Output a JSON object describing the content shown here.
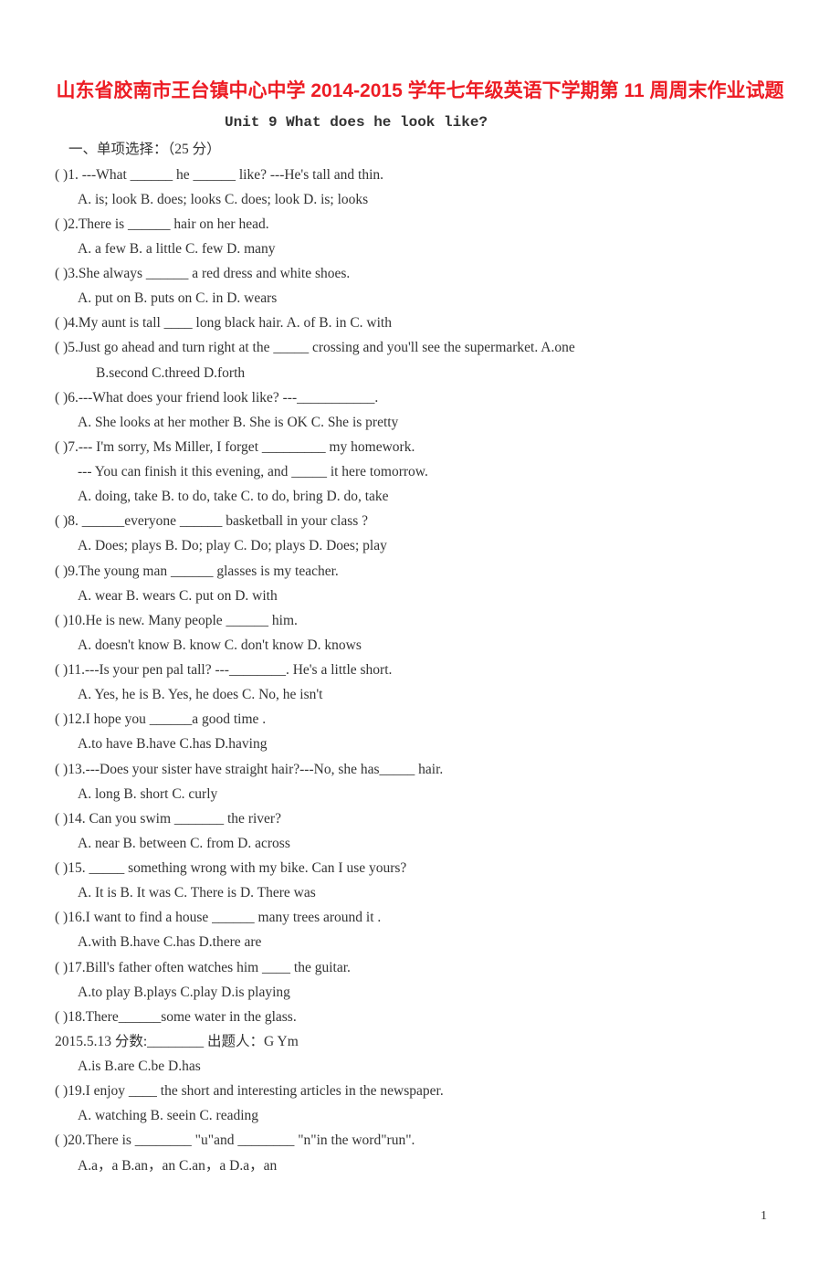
{
  "title": "山东省胶南市王台镇中心中学 2014-2015 学年七年级英语下学期第 11 周周末作业试题",
  "subtitle": "Unit 9 What does he look like?",
  "section_label": "一、单项选择：（25 分）",
  "questions": [
    {
      "q": "(  )1. ---What ______ he ______ like?      ---He's tall and thin.",
      "opts": "A. is; look   B. does; looks    C. does; look    D. is; looks"
    },
    {
      "q": "(  )2.There is ______ hair on her head.",
      "opts": "A. a few      B. a little   C. few     D. many"
    },
    {
      "q": "(  )3.She always ______ a red dress and white shoes.",
      "opts": "A. put on     B. puts on     C. in      D. wears"
    },
    {
      "q": "(  )4.My aunt is tall ____ long black hair.  A. of     B. in    C. with"
    },
    {
      "q": "(   )5.Just go ahead and turn right at the _____ crossing and you'll see the supermarket.    A.one",
      "opts2": "B.second   C.threed     D.forth"
    },
    {
      "q": "(  )6.---What does your friend look like?   ---___________.",
      "opts": "A. She looks at her mother    B. She is OK   C. She is pretty"
    },
    {
      "q": "(   )7.--- I'm sorry, Ms Miller, I forget _________ my homework.",
      "line2": "--- You can finish it this evening, and _____ it here tomorrow.",
      "opts": "A. doing, take    B. to do, take    C. to do, bring    D. do, take"
    },
    {
      "q": "(   )8. ______everyone ______ basketball in your class ?",
      "opts": "A. Does; plays    B. Do; play  C. Do; plays    D. Does; play"
    },
    {
      "q": "(  )9.The young man ______ glasses is my teacher.",
      "opts": "A. wear     B. wears        C. put on    D. with"
    },
    {
      "q": "(  )10.He is new. Many people ______ him.",
      "opts": "A. doesn't know      B. know  C. don't know   D. knows"
    },
    {
      "q": "(  )11.---Is your pen pal tall?     ---________. He's a little short.",
      "opts": "A. Yes, he is     B. Yes, he does    C. No, he isn't"
    },
    {
      "q": "(   )12.I hope you ______a good time .",
      "opts": "A.to have        B.have      C.has      D.having"
    },
    {
      "q": "(  )13.---Does your sister have straight hair?---No, she has_____ hair.",
      "opts": "A. long        B. short        C. curly"
    },
    {
      "q": "(   )14. Can you swim _______ the river?",
      "opts": "A. near     B. between     C. from      D. across"
    },
    {
      "q": "(   )15. _____ something wrong with my bike. Can I use yours?",
      "opts": "A. It is   B. It was   C. There is   D. There was"
    },
    {
      "q": "(   )16.I want to find a house ______ many trees around it .",
      "opts": "A.with       B.have       C.has       D.there are"
    },
    {
      "q": "(   )17.Bill's father often watches him ____ the guitar.",
      "opts": "A.to play      B.plays       C.play       D.is playing"
    },
    {
      "q": "(   )18.There______some water in the glass."
    },
    {
      "extra": "2015.5.13      分数:________        出题人：G  Ym"
    },
    {
      "opts": "A.is           B.are       C.be       D.has"
    },
    {
      "q": "(  )19.I enjoy ____ the short and interesting articles in the newspaper.",
      "opts": "A. watching  B. seein    C. reading"
    },
    {
      "q": "(  )20.There is ________ \"u\"and ________ \"n\"in the word\"run\".",
      "opts": "A.a，a           B.an，an         C.an，a         D.a，an"
    }
  ],
  "page_num": "1"
}
